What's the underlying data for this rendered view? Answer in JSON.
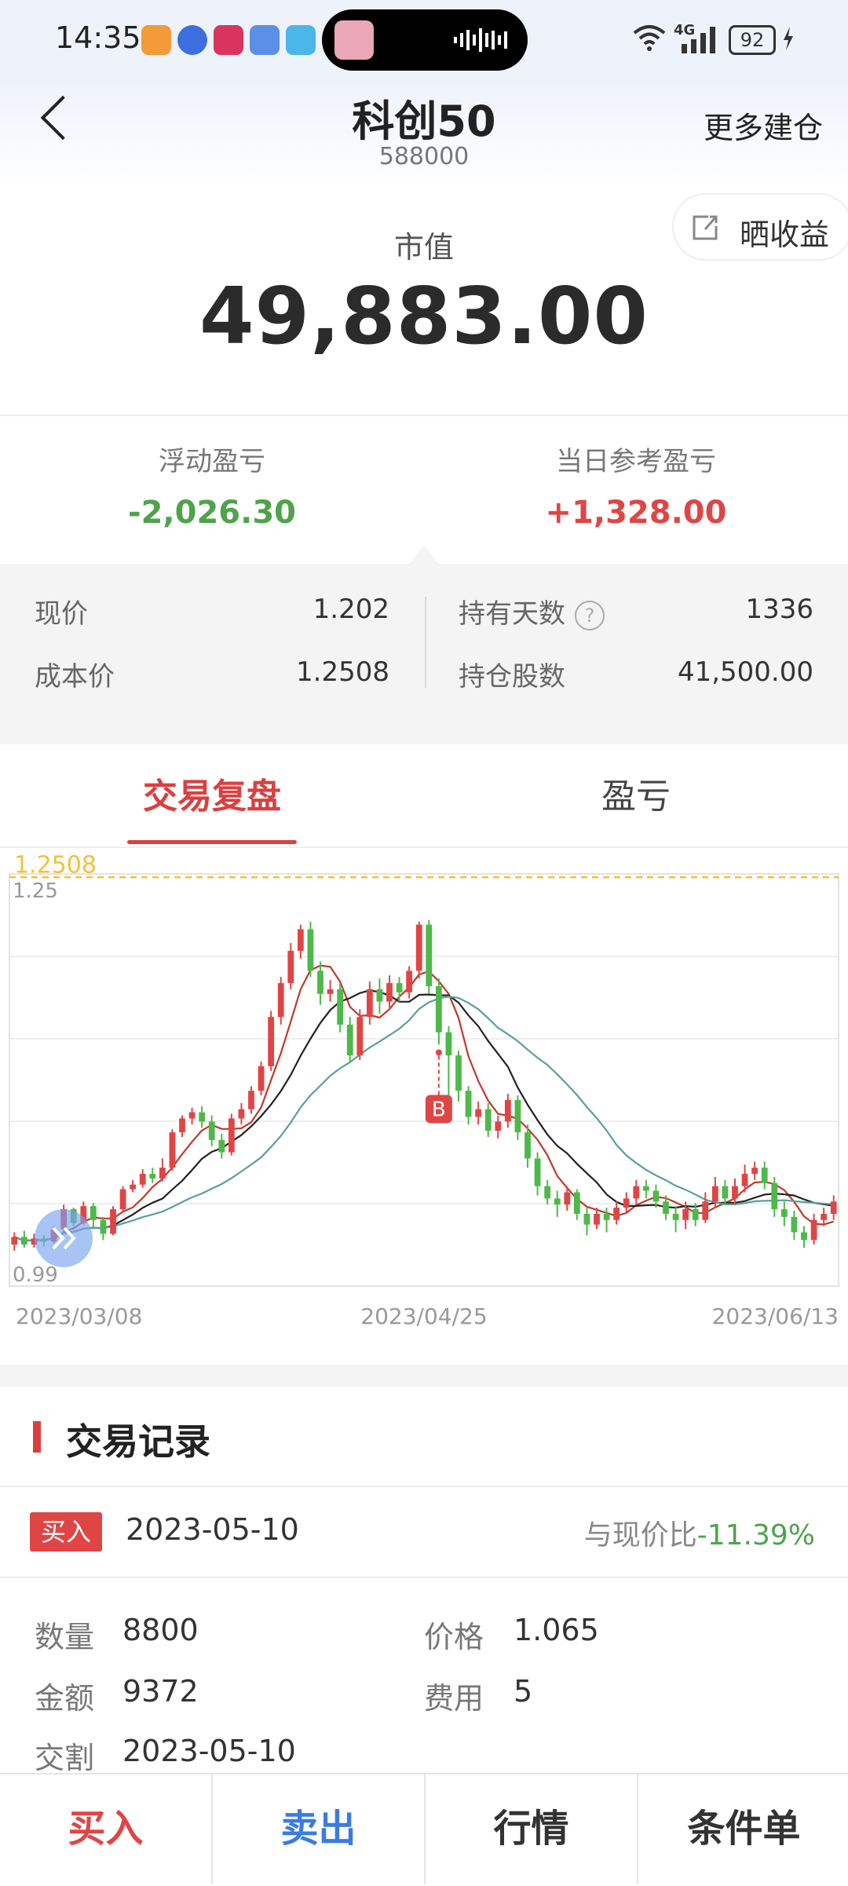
{
  "status_bar": {
    "time": "14:35",
    "network": "4G",
    "battery": "92"
  },
  "header": {
    "title": "科创50",
    "code": "588000",
    "more_label": "更多建仓",
    "share_label": "晒收益"
  },
  "summary": {
    "market_value_label": "市值",
    "market_value": "49,883.00"
  },
  "pnl": {
    "floating_label": "浮动盈亏",
    "floating_value": "-2,026.30",
    "daily_label": "当日参考盈亏",
    "daily_value": "+1,328.00"
  },
  "info": {
    "price_label": "现价",
    "price": "1.202",
    "cost_label": "成本价",
    "cost": "1.2508",
    "days_label": "持有天数",
    "days_help": "?",
    "days": "1336",
    "shares_label": "持仓股数",
    "shares": "41,500.00"
  },
  "tabs": {
    "active": "交易复盘",
    "inactive": "盈亏"
  },
  "chart_data": {
    "type": "candlestick",
    "cost_line": 1.2508,
    "cost_label": "1.2508",
    "y_top_label": "1.25",
    "y_bottom_label": "0.99",
    "ylim": [
      0.985,
      1.253
    ],
    "x_labels": [
      "2023/03/08",
      "2023/04/25",
      "2023/06/13"
    ],
    "marker": {
      "label": "B",
      "index": 43
    },
    "candles": [
      [
        1.012,
        1.017,
        1.008,
        1.02
      ],
      [
        1.017,
        1.012,
        1.01,
        1.021
      ],
      [
        1.012,
        1.016,
        1.01,
        1.019
      ],
      [
        1.016,
        1.014,
        1.011,
        1.018
      ],
      [
        1.014,
        1.022,
        1.013,
        1.024
      ],
      [
        1.022,
        1.035,
        1.02,
        1.038
      ],
      [
        1.035,
        1.026,
        1.024,
        1.036
      ],
      [
        1.026,
        1.037,
        1.025,
        1.04
      ],
      [
        1.037,
        1.028,
        1.022,
        1.039
      ],
      [
        1.028,
        1.019,
        1.015,
        1.03
      ],
      [
        1.019,
        1.035,
        1.018,
        1.037
      ],
      [
        1.035,
        1.048,
        1.033,
        1.05
      ],
      [
        1.048,
        1.051,
        1.046,
        1.054
      ],
      [
        1.051,
        1.058,
        1.049,
        1.061
      ],
      [
        1.058,
        1.055,
        1.052,
        1.062
      ],
      [
        1.055,
        1.062,
        1.053,
        1.068
      ],
      [
        1.062,
        1.085,
        1.06,
        1.087
      ],
      [
        1.085,
        1.094,
        1.082,
        1.096
      ],
      [
        1.094,
        1.098,
        1.09,
        1.101
      ],
      [
        1.098,
        1.092,
        1.088,
        1.102
      ],
      [
        1.092,
        1.08,
        1.076,
        1.096
      ],
      [
        1.08,
        1.072,
        1.068,
        1.084
      ],
      [
        1.072,
        1.094,
        1.07,
        1.097
      ],
      [
        1.094,
        1.1,
        1.09,
        1.104
      ],
      [
        1.1,
        1.112,
        1.097,
        1.115
      ],
      [
        1.112,
        1.128,
        1.109,
        1.131
      ],
      [
        1.128,
        1.16,
        1.125,
        1.164
      ],
      [
        1.16,
        1.182,
        1.155,
        1.186
      ],
      [
        1.182,
        1.203,
        1.178,
        1.208
      ],
      [
        1.203,
        1.217,
        1.198,
        1.22
      ],
      [
        1.217,
        1.19,
        1.186,
        1.222
      ],
      [
        1.19,
        1.175,
        1.168,
        1.196
      ],
      [
        1.175,
        1.178,
        1.17,
        1.184
      ],
      [
        1.178,
        1.155,
        1.15,
        1.182
      ],
      [
        1.155,
        1.135,
        1.13,
        1.16
      ],
      [
        1.135,
        1.16,
        1.132,
        1.165
      ],
      [
        1.16,
        1.178,
        1.155,
        1.183
      ],
      [
        1.178,
        1.17,
        1.162,
        1.185
      ],
      [
        1.17,
        1.182,
        1.166,
        1.187
      ],
      [
        1.182,
        1.176,
        1.17,
        1.186
      ],
      [
        1.176,
        1.19,
        1.172,
        1.193
      ],
      [
        1.19,
        1.22,
        1.185,
        1.222
      ],
      [
        1.22,
        1.18,
        1.175,
        1.223
      ],
      [
        1.18,
        1.15,
        1.142,
        1.185
      ],
      [
        1.15,
        1.135,
        1.108,
        1.154
      ],
      [
        1.135,
        1.112,
        1.105,
        1.138
      ],
      [
        1.112,
        1.095,
        1.09,
        1.115
      ],
      [
        1.095,
        1.1,
        1.09,
        1.105
      ],
      [
        1.1,
        1.086,
        1.082,
        1.104
      ],
      [
        1.086,
        1.092,
        1.081,
        1.096
      ],
      [
        1.092,
        1.106,
        1.088,
        1.11
      ],
      [
        1.106,
        1.085,
        1.08,
        1.109
      ],
      [
        1.085,
        1.068,
        1.062,
        1.09
      ],
      [
        1.068,
        1.05,
        1.044,
        1.072
      ],
      [
        1.05,
        1.042,
        1.038,
        1.054
      ],
      [
        1.042,
        1.038,
        1.03,
        1.047
      ],
      [
        1.038,
        1.046,
        1.034,
        1.05
      ],
      [
        1.046,
        1.032,
        1.028,
        1.048
      ],
      [
        1.032,
        1.025,
        1.018,
        1.036
      ],
      [
        1.025,
        1.032,
        1.022,
        1.036
      ],
      [
        1.032,
        1.028,
        1.02,
        1.036
      ],
      [
        1.028,
        1.036,
        1.025,
        1.04
      ],
      [
        1.036,
        1.042,
        1.032,
        1.046
      ],
      [
        1.042,
        1.05,
        1.038,
        1.054
      ],
      [
        1.05,
        1.047,
        1.042,
        1.054
      ],
      [
        1.047,
        1.04,
        1.036,
        1.051
      ],
      [
        1.04,
        1.032,
        1.028,
        1.044
      ],
      [
        1.032,
        1.028,
        1.02,
        1.037
      ],
      [
        1.028,
        1.035,
        1.022,
        1.04
      ],
      [
        1.035,
        1.028,
        1.024,
        1.039
      ],
      [
        1.028,
        1.04,
        1.026,
        1.046
      ],
      [
        1.04,
        1.05,
        1.036,
        1.056
      ],
      [
        1.05,
        1.042,
        1.038,
        1.054
      ],
      [
        1.042,
        1.05,
        1.038,
        1.055
      ],
      [
        1.05,
        1.058,
        1.046,
        1.064
      ],
      [
        1.058,
        1.062,
        1.054,
        1.066
      ],
      [
        1.062,
        1.052,
        1.048,
        1.066
      ],
      [
        1.052,
        1.035,
        1.03,
        1.056
      ],
      [
        1.035,
        1.03,
        1.024,
        1.04
      ],
      [
        1.03,
        1.02,
        1.015,
        1.034
      ],
      [
        1.02,
        1.015,
        1.01,
        1.024
      ],
      [
        1.015,
        1.028,
        1.012,
        1.032
      ],
      [
        1.028,
        1.032,
        1.024,
        1.036
      ],
      [
        1.032,
        1.04,
        1.028,
        1.044
      ]
    ]
  },
  "records": {
    "title": "交易记录",
    "badge": "买入",
    "date": "2023-05-10",
    "cmp_label": "与现价比",
    "cmp_value": "-11.39%",
    "qty_label": "数量",
    "qty": "8800",
    "price_label": "价格",
    "price": "1.065",
    "amount_label": "金额",
    "amount": "9372",
    "fee_label": "费用",
    "fee": "5",
    "settle_label": "交割",
    "settle": "2023-05-10"
  },
  "bottom_bar": {
    "buy": "买入",
    "sell": "卖出",
    "quote": "行情",
    "condition": "条件单"
  },
  "colors": {
    "up": "#e04545",
    "down": "#4fb84a",
    "accent": "#d94040",
    "sell_blue": "#3b7be0",
    "ma5": "#c0392b",
    "ma10": "#222222",
    "ma20": "#5b9ea0",
    "cost_line": "#f0c23c"
  }
}
